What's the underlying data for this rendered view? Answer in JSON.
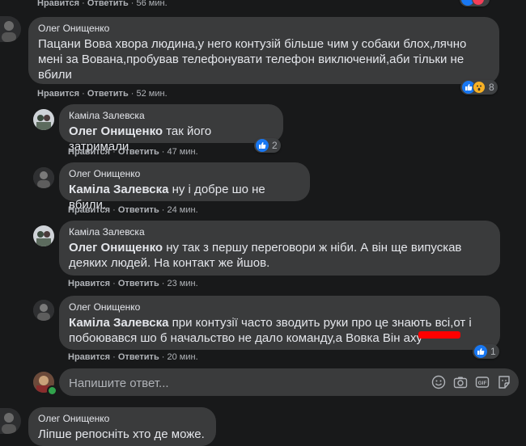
{
  "top_partial": {
    "like_label": "Нравится",
    "reply_label": "Ответить",
    "time": "56 мин."
  },
  "comments": [
    {
      "author": "Олег Онищенко",
      "text": "Пацани Вова хвора людина,у него контузій більше чим у собаки блох,лячно мені за Вована,пробував телефонувати телефон виключений,аби тільки не вбили",
      "like_label": "Нравится",
      "reply_label": "Ответить",
      "time": "52 мин.",
      "reaction_count": "8"
    },
    {
      "author": "Каміла Залевска",
      "mention": "Олег Онищенко",
      "text": "так його затримали",
      "like_label": "Нравится",
      "reply_label": "Ответить",
      "time": "47 мин.",
      "reaction_count": "2"
    },
    {
      "author": "Олег Онищенко",
      "mention": "Каміла Залевска",
      "text": "ну і добре шо не вбили.",
      "like_label": "Нравится",
      "reply_label": "Ответить",
      "time": "24 мин."
    },
    {
      "author": "Каміла Залевска",
      "mention": "Олег Онищенко",
      "text": "ну так з першу переговори ж ніби. А він ще випускав деяких людей. На контакт же йшов.",
      "like_label": "Нравится",
      "reply_label": "Ответить",
      "time": "23 мин."
    },
    {
      "author": "Олег Онищенко",
      "mention": "Каміла Залевска",
      "text": "при контузії часто зводить руки про це знають всі,от і побоювався шо б начальство не дало команду,а Вовка Він аху",
      "like_label": "Нравится",
      "reply_label": "Ответить",
      "time": "20 мин.",
      "reaction_count": "1"
    },
    {
      "author": "Олег Онищенко",
      "text": "Ліпше репосніть хто де може."
    }
  ],
  "composer": {
    "placeholder": "Напишите ответ..."
  },
  "icons": [
    "like-icon",
    "wow-icon",
    "emoji-icon",
    "camera-icon",
    "gif-icon",
    "sticker-icon"
  ],
  "colors": {
    "background": "#18191a",
    "bubble": "#3a3b3c",
    "like_blue": "#1877f2",
    "redaction": "#ff0000"
  }
}
